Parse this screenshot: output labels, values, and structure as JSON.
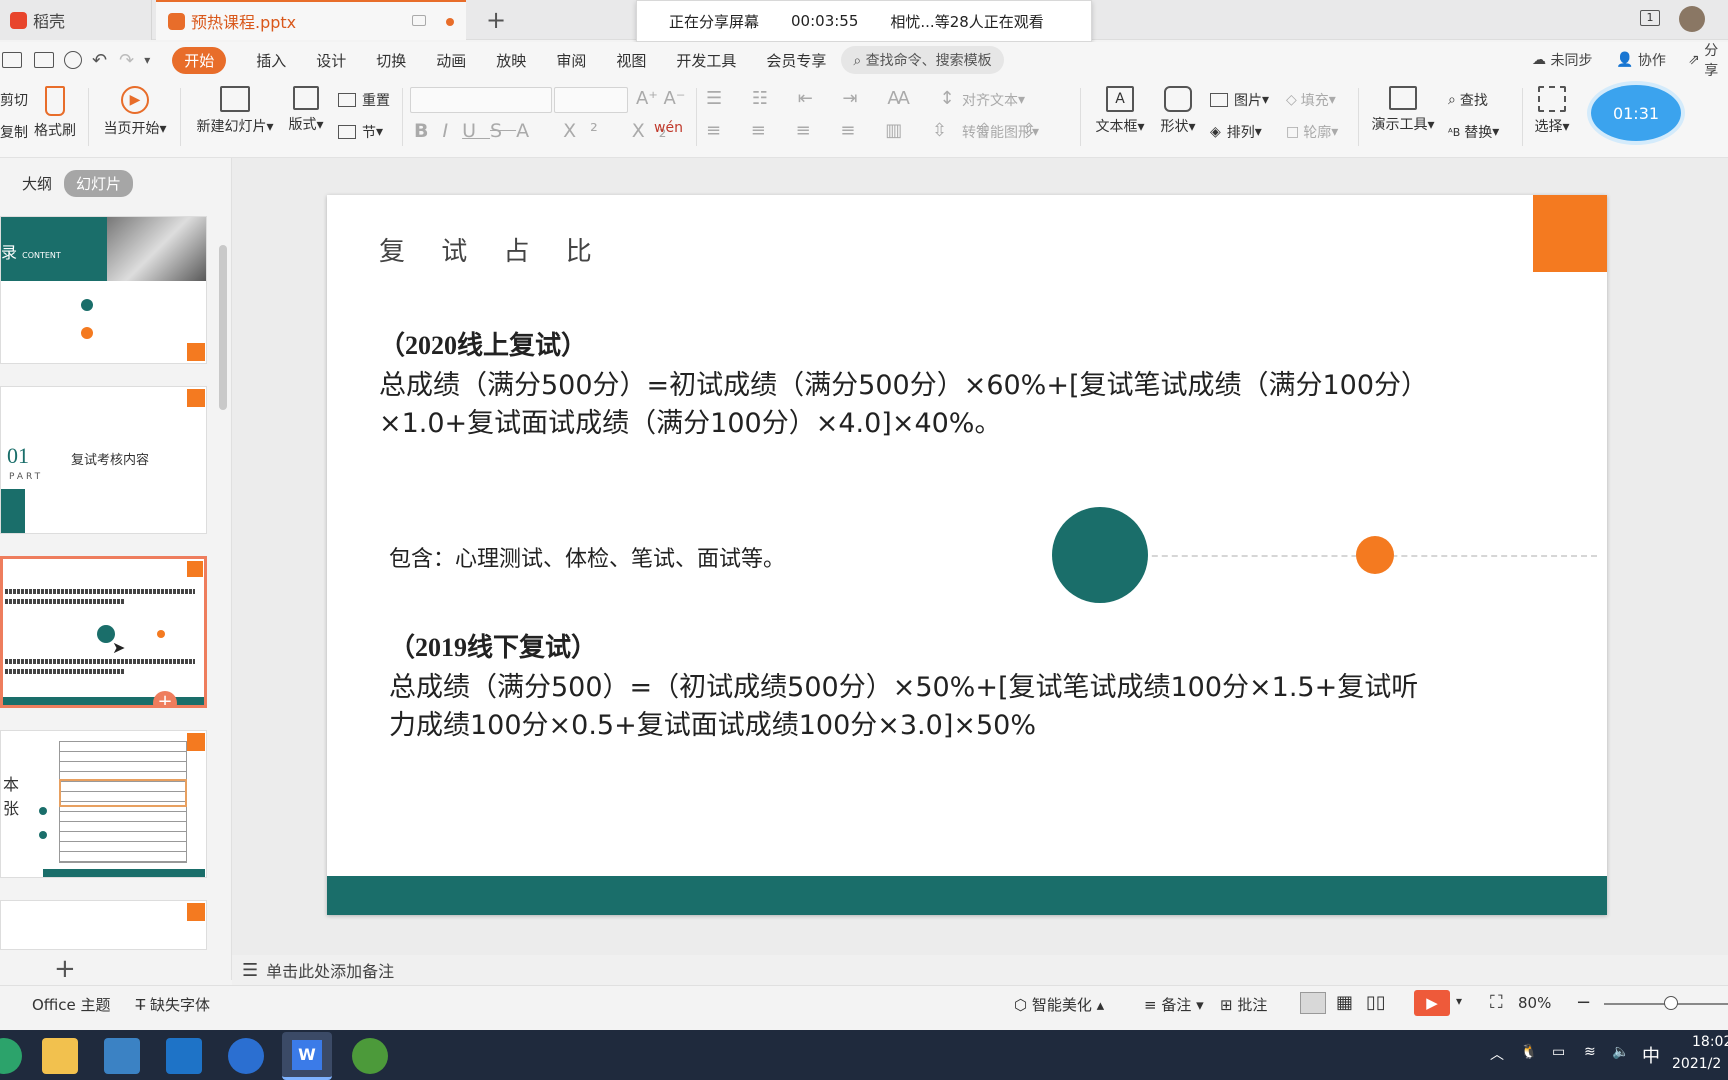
{
  "tabs": {
    "home": "稻壳",
    "doc": "预热课程.pptx"
  },
  "share": {
    "status": "正在分享屏幕",
    "time": "00:03:55",
    "viewers": "相忧...等28人正在观看"
  },
  "ribbon_tabs": [
    "开始",
    "插入",
    "设计",
    "切换",
    "动画",
    "放映",
    "审阅",
    "视图",
    "开发工具",
    "会员专享"
  ],
  "search_cmd": "查找命令、搜索模板",
  "ribbon_right": {
    "sync": "未同步",
    "collab": "协作",
    "share": "分享"
  },
  "toolbar": {
    "cut": "剪切",
    "copy": "复制",
    "format_painter": "格式刷",
    "play_current": "当页开始",
    "new_slide": "新建幻灯片",
    "layout": "版式",
    "reset": "重置",
    "section": "节",
    "align_text": "对齐文本",
    "smart_shape": "转智能图形",
    "textbox": "文本框",
    "shape": "形状",
    "picture": "图片",
    "arrange": "排列",
    "fill": "填充",
    "outline": "轮廓",
    "present_tools": "演示工具",
    "find": "查找",
    "replace": "替换",
    "select": "选择"
  },
  "timer": "01:31",
  "view_tabs": {
    "outline": "大纲",
    "slides": "幻灯片"
  },
  "thumb2": {
    "num": "01",
    "part": "PART",
    "title": "复试考核内容"
  },
  "thumb1": {
    "title_char": "录",
    "sub": "CONTENT"
  },
  "thumb4": {
    "c1": "本",
    "c2": "张"
  },
  "slide": {
    "title": "复 试 占 比",
    "h1": "（2020线上复试）",
    "p1a": "总成绩（满分500分）=初试成绩（满分500分）×60%+[复试笔试成绩（满分100分）",
    "p1b": "×1.0+复试面试成绩（满分100分）×4.0]×40%。",
    "includes": "包含：心理测试、体检、笔试、面试等。",
    "h2": "（2019线下复试）",
    "p2a": "总成绩（满分500）=（初试成绩500分）×50%+[复试笔试成绩100分×1.5+复试听",
    "p2b": "力成绩100分×0.5+复试面试成绩100分×3.0]×50%"
  },
  "notes": "单击此处添加备注",
  "status": {
    "theme": "Office 主题",
    "missing_font": "缺失字体",
    "beautify": "智能美化",
    "notes_btn": "备注",
    "comments": "批注",
    "zoom": "80%"
  },
  "taskbar": {
    "time": "18:02",
    "date": "2021/2",
    "ime": "中"
  },
  "colors": {
    "accent": "#e86d2a",
    "teal": "#1a6e6a",
    "orange": "#f47a20"
  }
}
